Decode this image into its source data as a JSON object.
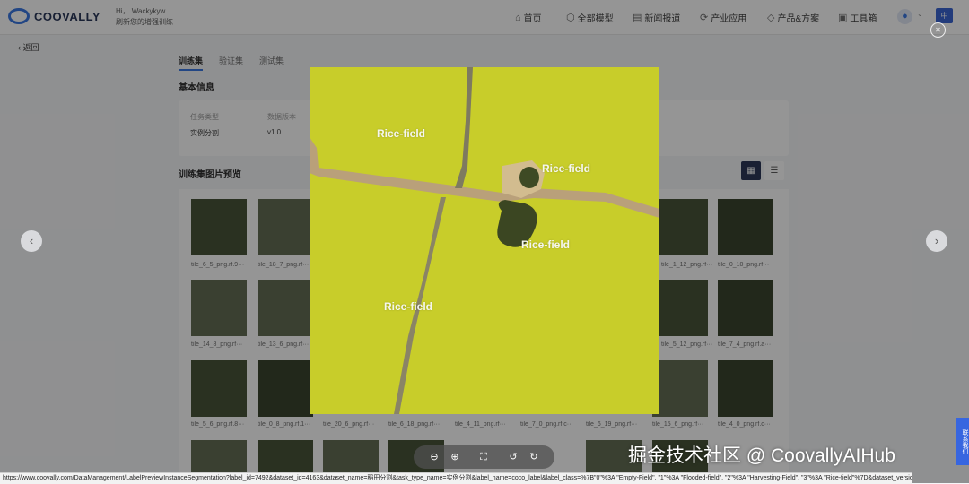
{
  "header": {
    "logo_text": "COOVALLY",
    "greeting": "Hi，",
    "username": "Wackykyw",
    "subtitle": "刷新您的增强训练",
    "nav": [
      {
        "icon": "home-icon",
        "glyph": "⌂",
        "label": "首页"
      },
      {
        "icon": "models-icon",
        "glyph": "⬡",
        "label": "全部模型"
      },
      {
        "icon": "news-icon",
        "glyph": "▤",
        "label": "新闻报道"
      },
      {
        "icon": "industry-icon",
        "glyph": "⟳",
        "label": "产业应用"
      },
      {
        "icon": "products-icon",
        "glyph": "◇",
        "label": "产品&方案"
      },
      {
        "icon": "toolbox-icon",
        "glyph": "▣",
        "label": "工具箱"
      }
    ],
    "lang_label": "中"
  },
  "page": {
    "back_label": "返回",
    "tabs": [
      {
        "label": "训练集",
        "active": true
      },
      {
        "label": "验证集",
        "active": false
      },
      {
        "label": "测试集",
        "active": false
      }
    ],
    "basic_info_title": "基本信息",
    "info": {
      "task_type_label": "任务类型",
      "task_type_value": "实例分割",
      "data_version_label": "数据版本",
      "data_version_value": "v1.0"
    },
    "preview_title": "训练集图片预览",
    "thumbs": [
      {
        "caption": "tile_6_5_png.rf.9···"
      },
      {
        "caption": "tile_18_7_png.rf···"
      },
      {
        "caption": "tile_1_12_png.rf···"
      },
      {
        "caption": "tile_0_10_png.rf···"
      },
      {
        "caption": "tile_14_8_png.rf···"
      },
      {
        "caption": "tile_13_6_png.rf···"
      },
      {
        "caption": "tile_5_12_png.rf···"
      },
      {
        "caption": "tile_7_4_png.rf.a···"
      },
      {
        "caption": "tile_5_6_png.rf.8···"
      },
      {
        "caption": "tile_0_8_png.rf.1···"
      },
      {
        "caption": "tile_20_6_png.rf···"
      },
      {
        "caption": "tile_6_18_png.rf···"
      },
      {
        "caption": "tile_4_11_png.rf···"
      },
      {
        "caption": "tile_7_0_png.rf.c···"
      },
      {
        "caption": "tile_6_19_png.rf···"
      },
      {
        "caption": "tile_15_6_png.rf···"
      },
      {
        "caption": "tile_4_0_png.rf.c···"
      }
    ]
  },
  "preview": {
    "labels": [
      "Rice-field",
      "Rice-field",
      "Rice-field",
      "Rice-field"
    ],
    "field_color": "#c8cd2a",
    "road_color": "#b9a07a"
  },
  "toolbar": {
    "zoom_out_icon": "zoom-out-icon",
    "zoom_in_icon": "zoom-in-icon",
    "fullscreen_icon": "fullscreen-icon",
    "rotate_left_icon": "rotate-left-icon",
    "rotate_right_icon": "rotate-right-icon"
  },
  "contact_label": "联系我们",
  "status_url": "https://www.coovally.com/DataManagement/LabelPreviewInstanceSegmentation?label_id=7492&dataset_id=4163&dataset_name=稻田分割&task_type_name=实例分割&label_name=coco_label&label_class=%7B\"0\"%3A \"Empty-Field\", \"1\"%3A \"Flooded-field\", \"2\"%3A \"Harvesting-Field\", \"3\"%3A \"Rice-field\"%7D&dataset_version=v1.0#",
  "watermark": "掘金技术社区 @ CoovallyAIHub"
}
